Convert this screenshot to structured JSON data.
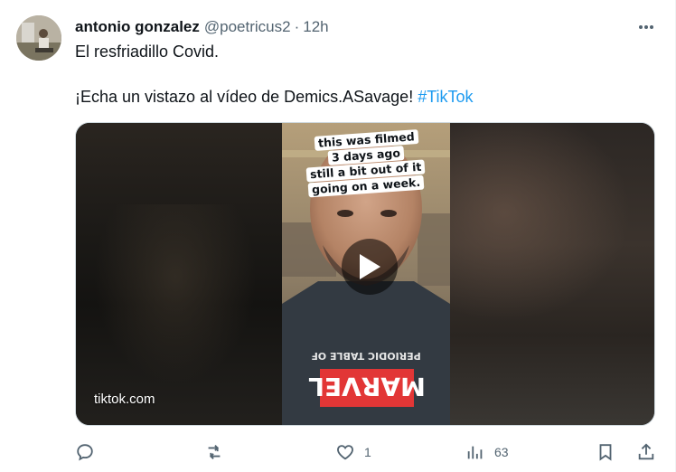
{
  "tweet": {
    "author_name": "antonio gonzalez",
    "handle": "@poetricus2",
    "separator": "·",
    "time": "12h",
    "text_line1": "El resfriadillo Covid.",
    "text_line2_prefix": "¡Echa un vistazo al vídeo de Demics.ASavage! ",
    "hashtag": "#TikTok",
    "more_icon": "more-dots-icon"
  },
  "media": {
    "caption_lines": [
      "this was filmed",
      "3 days ago",
      "still a bit out of it",
      "going on a week."
    ],
    "source_label": "tiktok.com",
    "shirt_top_text": "PERIODIC TABLE OF",
    "shirt_logo_text": "MARVEL",
    "play_icon": "play-icon"
  },
  "actions": {
    "reply": {
      "icon": "reply-icon",
      "count": ""
    },
    "repost": {
      "icon": "repost-icon",
      "count": ""
    },
    "like": {
      "icon": "heart-icon",
      "count": "1"
    },
    "views": {
      "icon": "views-icon",
      "count": "63"
    },
    "bookmark": {
      "icon": "bookmark-icon",
      "count": ""
    },
    "share": {
      "icon": "share-icon",
      "count": ""
    }
  },
  "colors": {
    "link": "#1d9bf0",
    "secondary_text": "#536471",
    "primary_text": "#0f1419",
    "marvel_red": "#e23636"
  }
}
